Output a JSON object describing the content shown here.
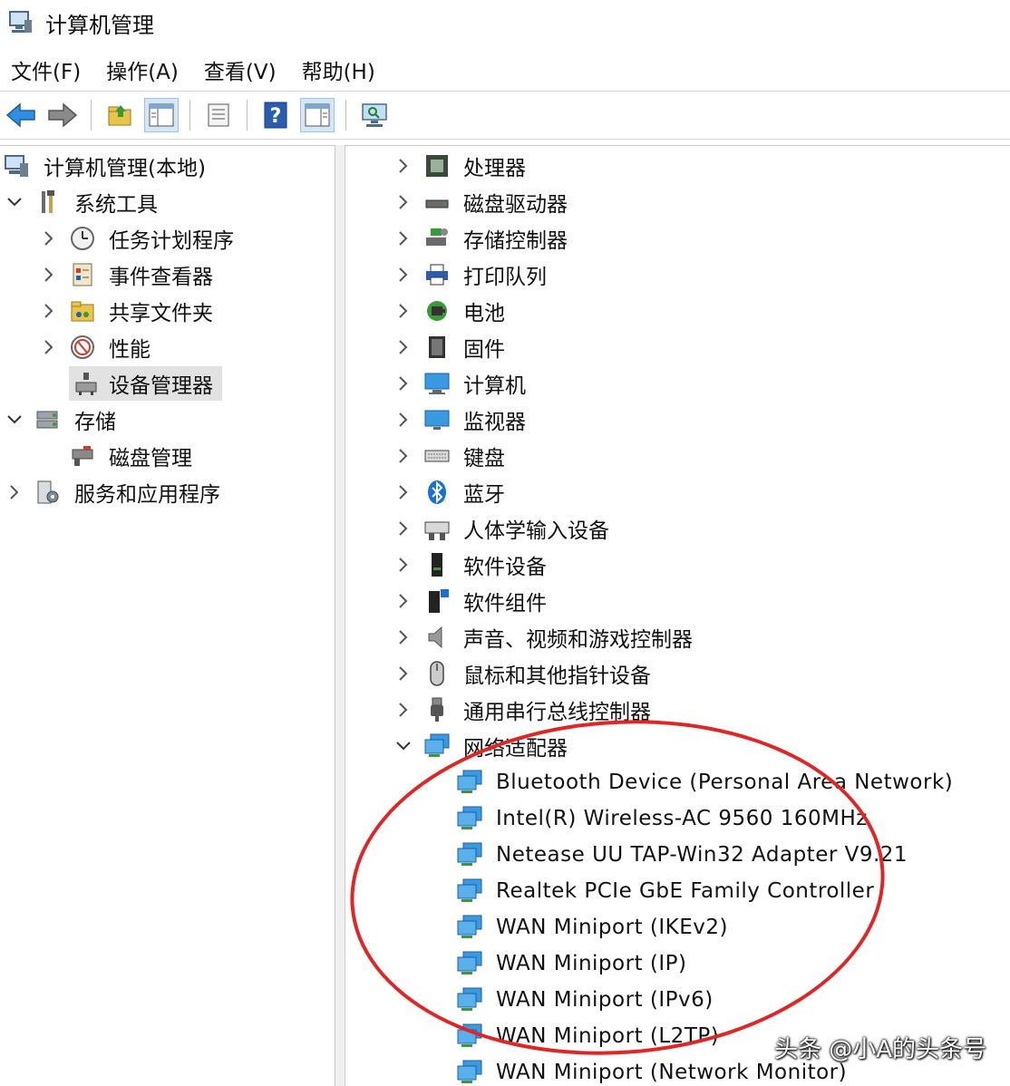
{
  "window": {
    "title": "计算机管理"
  },
  "menu": {
    "items": [
      "文件(F)",
      "操作(A)",
      "查看(V)",
      "帮助(H)"
    ]
  },
  "toolbar": {
    "buttons": [
      "back-arrow-icon",
      "forward-arrow-icon",
      "up-folder-icon",
      "show-hide-tree-icon",
      "properties-icon",
      "help-icon",
      "show-action-pane-icon",
      "monitor-icon"
    ]
  },
  "left_tree": {
    "root": "计算机管理(本地)",
    "system_tools": "系统工具",
    "task_scheduler": "任务计划程序",
    "event_viewer": "事件查看器",
    "shared_folders": "共享文件夹",
    "performance": "性能",
    "device_manager": "设备管理器",
    "storage": "存储",
    "disk_management": "磁盘管理",
    "services_apps": "服务和应用程序"
  },
  "device_tree": {
    "categories": [
      "处理器",
      "磁盘驱动器",
      "存储控制器",
      "打印队列",
      "电池",
      "固件",
      "计算机",
      "监视器",
      "键盘",
      "蓝牙",
      "人体学输入设备",
      "软件设备",
      "软件组件",
      "声音、视频和游戏控制器",
      "鼠标和其他指针设备",
      "通用串行总线控制器",
      "网络适配器"
    ],
    "network_adapters": [
      "Bluetooth Device (Personal Area Network)",
      "Intel(R) Wireless-AC 9560 160MHz",
      "Netease UU TAP-Win32 Adapter V9.21",
      "Realtek PCIe GbE Family Controller",
      "WAN Miniport (IKEv2)",
      "WAN Miniport (IP)",
      "WAN Miniport (IPv6)",
      "WAN Miniport (L2TP)",
      "WAN Miniport (Network Monitor)"
    ]
  },
  "watermark": "头条 @小A的头条号",
  "colors": {
    "annotation": "#e12424",
    "selected_bg": "#e2e2e2",
    "toolbar_pressed": "#d5e7f7"
  }
}
